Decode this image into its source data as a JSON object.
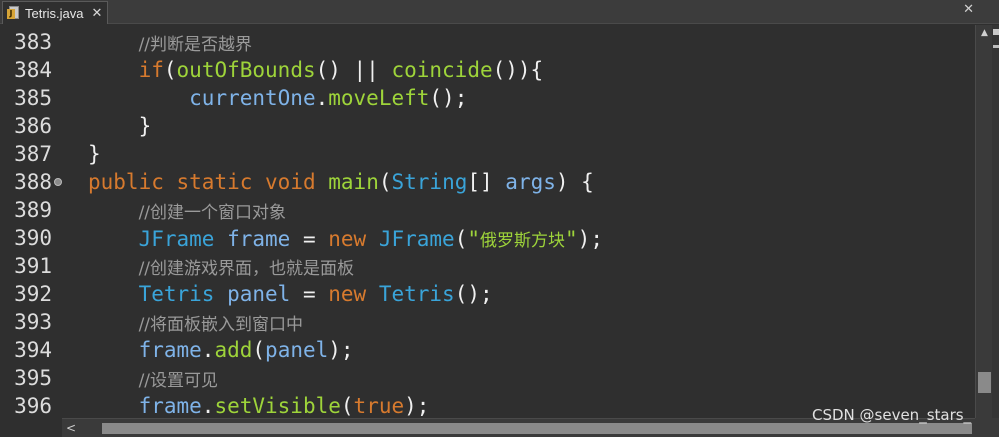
{
  "tab": {
    "label": "Tetris.java",
    "close": "✕",
    "icon": "java-file-icon"
  },
  "view_close": "✕",
  "lines": {
    "l383": {
      "num": "383",
      "comment": "//判断是否越界"
    },
    "l384": {
      "num": "384",
      "kw_if": "if",
      "p1": "(",
      "fn1": "outOfBounds",
      "p2": "() || ",
      "fn2": "coincide",
      "p3": "()){"
    },
    "l385": {
      "num": "385",
      "var": "currentOne",
      "dot": ".",
      "fn": "moveLeft",
      "rest": "();"
    },
    "l386": {
      "num": "386",
      "brace": "}"
    },
    "l387": {
      "num": "387",
      "brace": "}"
    },
    "l388": {
      "num": "388",
      "kw1": "public",
      "kw2": "static",
      "kw3": "void",
      "fn": "main",
      "p1": "(",
      "type": "String",
      "p2": "[] ",
      "var": "args",
      "p3": ") {"
    },
    "l389": {
      "num": "389",
      "comment": "//创建一个窗口对象"
    },
    "l390": {
      "num": "390",
      "type1": "JFrame",
      "var": "frame",
      "eq": " = ",
      "kw": "new",
      "type2": "JFrame",
      "p1": "(",
      "q1": "\"",
      "str": "俄罗斯方块",
      "q2": "\"",
      "p2": ");"
    },
    "l391": {
      "num": "391",
      "comment": "//创建游戏界面，也就是面板"
    },
    "l392": {
      "num": "392",
      "type1": "Tetris",
      "var": "panel",
      "eq": " = ",
      "kw": "new",
      "type2": "Tetris",
      "p": "();"
    },
    "l393": {
      "num": "393",
      "comment": "//将面板嵌入到窗口中"
    },
    "l394": {
      "num": "394",
      "var1": "frame",
      "dot": ".",
      "fn": "add",
      "p1": "(",
      "var2": "panel",
      "p2": ");"
    },
    "l395": {
      "num": "395",
      "comment": "//设置可见"
    },
    "l396": {
      "num": "396",
      "var": "frame",
      "dot": ".",
      "fn": "setVisible",
      "p1": "(",
      "kw": "true",
      "p2": ");"
    }
  },
  "scroll": {
    "up": "▲",
    "left": "<"
  },
  "watermark": "CSDN @seven_stars_",
  "colors": {
    "background": "#2f2f2f",
    "keyword": "#d77a2e",
    "method": "#9ed43a",
    "type": "#3aa4d9",
    "variable": "#7fb3e8",
    "comment": "#9a9a9a"
  }
}
